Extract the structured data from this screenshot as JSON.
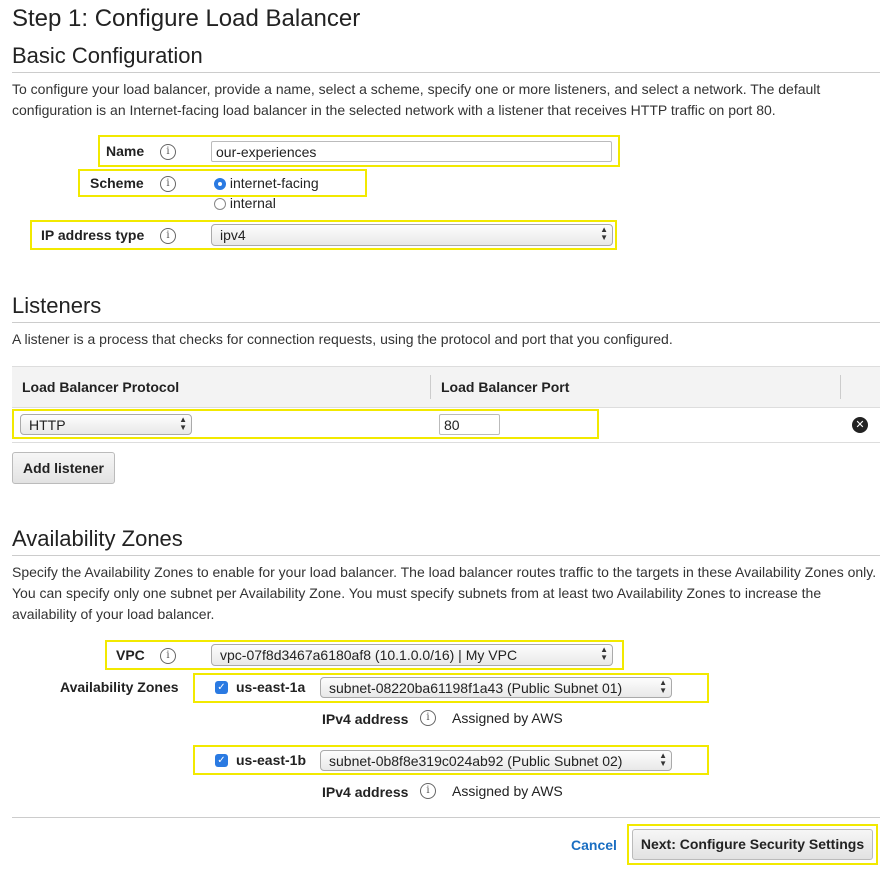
{
  "page": {
    "step_title": "Step 1: Configure Load Balancer"
  },
  "basic": {
    "heading": "Basic Configuration",
    "description": "To configure your load balancer, provide a name, select a scheme, specify one or more listeners, and select a network. The default configuration is an Internet-facing load balancer in the selected network with a listener that receives HTTP traffic on port 80.",
    "name_label": "Name",
    "name_value": "our-experiences",
    "scheme_label": "Scheme",
    "scheme_options": [
      "internet-facing",
      "internal"
    ],
    "scheme_selected": "internet-facing",
    "ip_label": "IP address type",
    "ip_value": "ipv4"
  },
  "listeners": {
    "heading": "Listeners",
    "description": "A listener is a process that checks for connection requests, using the protocol and port that you configured.",
    "columns": [
      "Load Balancer Protocol",
      "Load Balancer Port"
    ],
    "rows": [
      {
        "protocol": "HTTP",
        "port": "80"
      }
    ],
    "add_label": "Add listener"
  },
  "az": {
    "heading": "Availability Zones",
    "description": "Specify the Availability Zones to enable for your load balancer. The load balancer routes traffic to the targets in these Availability Zones only. You can specify only one subnet per Availability Zone. You must specify subnets from at least two Availability Zones to increase the availability of your load balancer.",
    "vpc_label": "VPC",
    "vpc_value": "vpc-07f8d3467a6180af8 (10.1.0.0/16) | My VPC",
    "zones_label": "Availability Zones",
    "zones": [
      {
        "name": "us-east-1a",
        "subnet": "subnet-08220ba61198f1a43 (Public Subnet 01)",
        "ipv4_label": "IPv4 address",
        "ipv4_value": "Assigned by AWS"
      },
      {
        "name": "us-east-1b",
        "subnet": "subnet-0b8f8e319c024ab92 (Public Subnet 02)",
        "ipv4_label": "IPv4 address",
        "ipv4_value": "Assigned by AWS"
      }
    ]
  },
  "footer": {
    "cancel_label": "Cancel",
    "next_label": "Next: Configure Security Settings"
  },
  "colors": {
    "highlight": "#f2e900",
    "link": "#1a6ec2",
    "checkbox": "#2a7ae2"
  },
  "icons": {
    "info": "info-icon",
    "remove": "close-circle-icon",
    "select": "updown-arrows-icon"
  }
}
